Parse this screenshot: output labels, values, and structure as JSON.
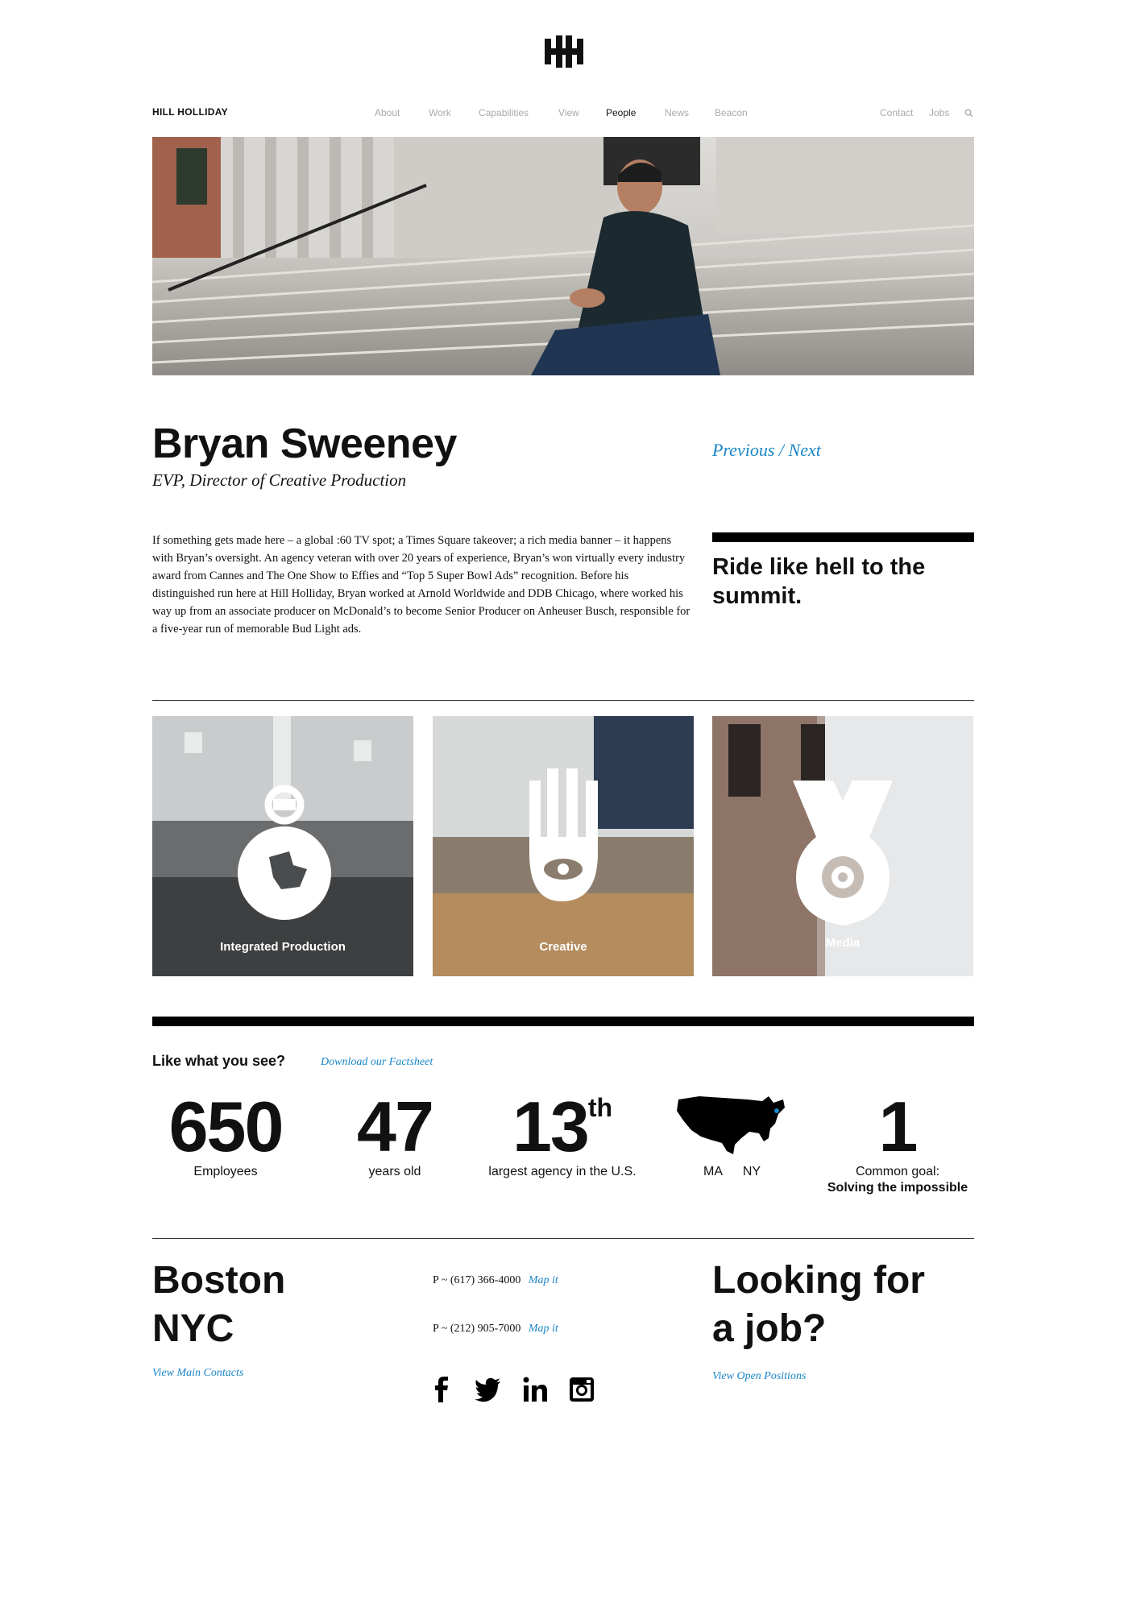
{
  "brand": {
    "name": "HILL HOLLIDAY"
  },
  "nav": {
    "items": [
      "About",
      "Work",
      "Capabilities",
      "View",
      "People",
      "News",
      "Beacon"
    ],
    "active": "People",
    "right": [
      "Contact",
      "Jobs"
    ]
  },
  "profile": {
    "name": "Bryan Sweeney",
    "title": "EVP, Director of Creative Production",
    "prev_label": "Previous",
    "sep": "/",
    "next_label": "Next",
    "bio": "If something gets made here – a global :60 TV spot; a Times Square takeover; a rich media banner – it happens with Bryan’s oversight. An agency veteran with over 20 years of experience, Bryan’s won virtually every industry award from Cannes and The One Show to Effies and “Top 5 Super Bowl Ads” recognition. Before his distinguished run here at Hill Holliday, Bryan worked at Arnold Worldwide and DDB Chicago, where worked his way up from an associate producer on McDonald’s to become Senior Producer on Anheuser Busch, responsible for a five-year run of memorable Bud Light ads.",
    "quote": "Ride like hell to the summit."
  },
  "capabilities": [
    {
      "label": "Integrated Production"
    },
    {
      "label": "Creative"
    },
    {
      "label": "Media"
    }
  ],
  "factsheet": {
    "heading": "Like what you see?",
    "link": "Download our Factsheet"
  },
  "stats": {
    "employees": {
      "value": "650",
      "caption": "Employees"
    },
    "age": {
      "value": "47",
      "caption": "years old"
    },
    "rank": {
      "value": "13",
      "suffix": "th",
      "caption": "largest agency in the U.S."
    },
    "locations": {
      "a": "MA",
      "b": "NY"
    },
    "goal": {
      "value": "1",
      "caption": "Common goal:",
      "caption_bold": "Solving the impossible"
    }
  },
  "footer": {
    "city1": "Boston",
    "city2": "NYC",
    "contacts_link": "View Main Contacts",
    "phone1": "P ~ (617) 366-4000",
    "phone2": "P ~ (212) 905-7000",
    "map_label": "Map it",
    "job_heading_1": "Looking for",
    "job_heading_2": "a job?",
    "jobs_link": "View Open Positions",
    "social": [
      "facebook-icon",
      "twitter-icon",
      "linkedin-icon",
      "instagram-icon"
    ]
  },
  "colors": {
    "link": "#1a86c6",
    "text": "#111111",
    "nav_muted": "#aaaaaa"
  }
}
